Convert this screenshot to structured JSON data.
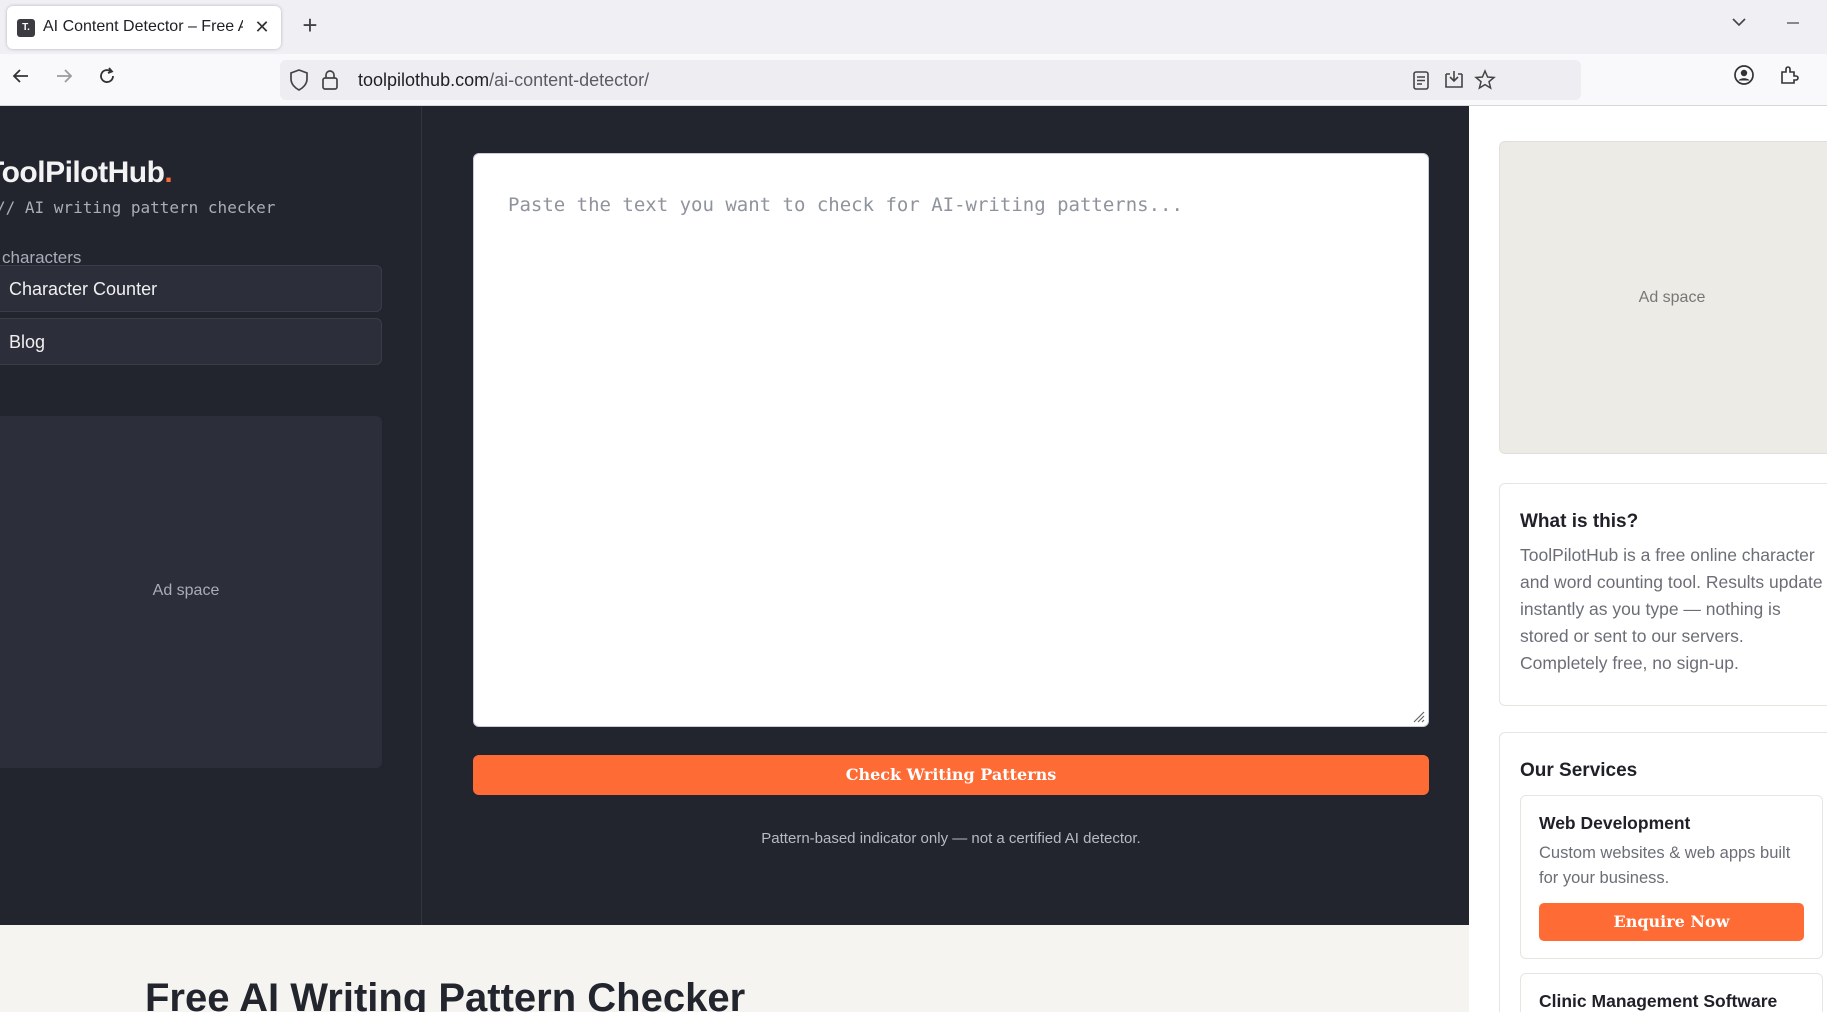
{
  "browser": {
    "tab_title": "AI Content Detector – Free AI D",
    "favicon_text": "T.",
    "url_domain": "toolpilothub.com",
    "url_path": "/ai-content-detector/"
  },
  "sidebar": {
    "logo": "ToolPilotHub",
    "logo_dot": ".",
    "tagline": "// AI writing pattern checker",
    "section_label": "characters",
    "items": [
      {
        "label": "Character Counter"
      },
      {
        "label": "Blog"
      }
    ],
    "ad_label": "Ad space"
  },
  "main": {
    "textarea_placeholder": "Paste the text you want to check for AI-writing patterns...",
    "check_button": "Check Writing Patterns",
    "disclaimer": "Pattern-based indicator only — not a certified AI detector.",
    "heading": "Free AI Writing Pattern Checker"
  },
  "right": {
    "ad_label": "Ad space",
    "about": {
      "title": "What is this?",
      "body": "ToolPilotHub is a free online character and word counting tool. Results update instantly as you type — nothing is stored or sent to our servers. Completely free, no sign-up."
    },
    "services": {
      "title": "Our Services",
      "items": [
        {
          "name": "Web Development",
          "desc": "Custom websites & web apps built for your business.",
          "button": "Enquire Now"
        },
        {
          "name": "Clinic Management Software"
        }
      ]
    }
  },
  "colors": {
    "accent": "#ff6b35",
    "dark_bg": "#22252e"
  }
}
